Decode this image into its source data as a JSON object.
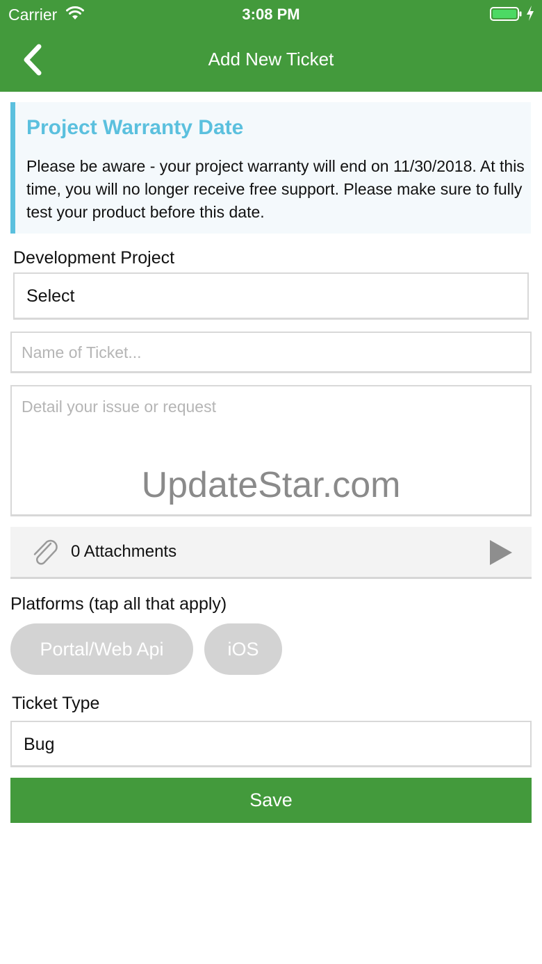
{
  "status_bar": {
    "carrier": "Carrier",
    "time": "3:08 PM",
    "battery_color": "#4cd964"
  },
  "nav": {
    "title": "Add New Ticket",
    "back_icon": "chevron-left-icon"
  },
  "notice": {
    "title": "Project Warranty Date",
    "body": "Please be aware - your project warranty will end on 11/30/2018. At this time, you will no longer receive free support. Please make sure to fully test your product before this date.",
    "accent_color": "#5bc0de"
  },
  "form": {
    "project_label": "Development Project",
    "project_value": "Select",
    "ticket_name_placeholder": "Name of Ticket...",
    "details_placeholder": "Detail your issue or request",
    "attachments_label": "0 Attachments",
    "platforms_label": "Platforms (tap all that apply)",
    "platforms": [
      "Portal/Web Api",
      "iOS"
    ],
    "ticket_type_label": "Ticket Type",
    "ticket_type_value": "Bug",
    "save_label": "Save"
  },
  "watermark": "UpdateStar.com",
  "brand_color": "#439a3c"
}
